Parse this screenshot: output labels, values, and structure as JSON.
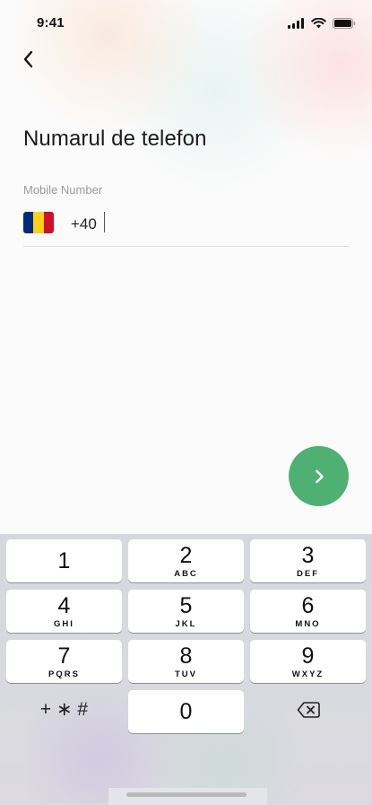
{
  "status_bar": {
    "time": "9:41",
    "icons": [
      "signal-icon",
      "wifi-icon",
      "battery-icon"
    ]
  },
  "nav": {
    "back_icon": "chevron-left-icon"
  },
  "screen": {
    "title": "Numarul de telefon",
    "field_label": "Mobile Number",
    "country_flag": "Romania",
    "flag_colors": [
      "#002B7F",
      "#FCD116",
      "#CE1126"
    ],
    "country_code": "+40",
    "phone_value": ""
  },
  "next_button": {
    "icon": "chevron-right-icon",
    "color": "#4eb073"
  },
  "keypad": {
    "keys": [
      {
        "num": "1",
        "letters": ""
      },
      {
        "num": "2",
        "letters": "ABC"
      },
      {
        "num": "3",
        "letters": "DEF"
      },
      {
        "num": "4",
        "letters": "GHI"
      },
      {
        "num": "5",
        "letters": "JKL"
      },
      {
        "num": "6",
        "letters": "MNO"
      },
      {
        "num": "7",
        "letters": "PQRS"
      },
      {
        "num": "8",
        "letters": "TUV"
      },
      {
        "num": "9",
        "letters": "WXYZ"
      },
      {
        "num": "0",
        "letters": ""
      }
    ],
    "symbols_label": "+ ∗ #",
    "delete_icon": "backspace-icon"
  }
}
